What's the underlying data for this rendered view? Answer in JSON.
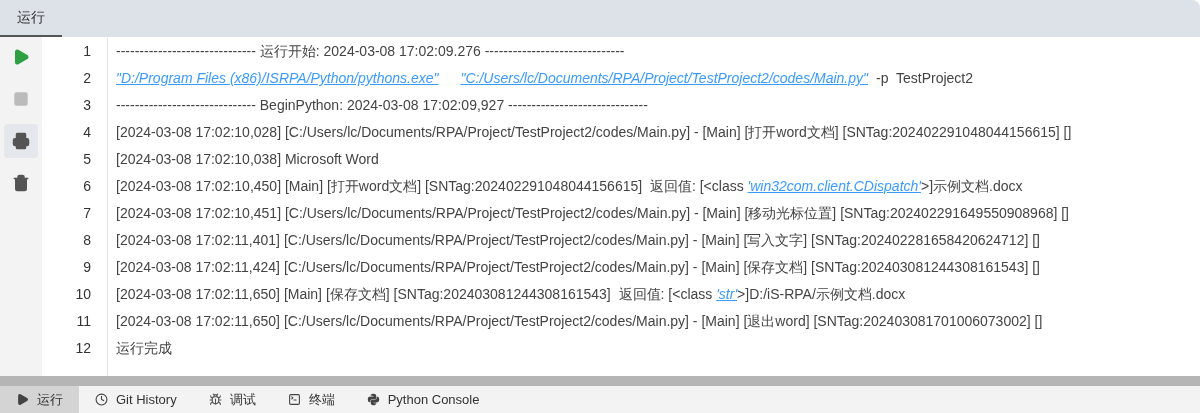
{
  "top_tabs": [
    {
      "label": "运行",
      "selected": true
    }
  ],
  "toolbar": [
    {
      "kind": "run",
      "disabled": false,
      "selected": false
    },
    {
      "kind": "stop",
      "disabled": true,
      "selected": false
    },
    {
      "kind": "print",
      "disabled": false,
      "selected": true
    },
    {
      "kind": "clear",
      "disabled": false,
      "selected": false
    }
  ],
  "lines": [
    {
      "number": "1",
      "segments": [
        {
          "kind": "text",
          "text": "------------------------------ 运行开始: 2024-03-08 17:02:09.276 ------------------------------"
        }
      ]
    },
    {
      "number": "2",
      "segments": [
        {
          "kind": "link",
          "text": "\"D:/Program Files (x86)/ISRPA/Python/pythons.exe\""
        },
        {
          "kind": "link",
          "text": "\"C:/Users/lc/Documents/RPA/Project/TestProject2/codes/Main.py\""
        },
        {
          "kind": "text",
          "text": "-p  TestProject2"
        }
      ]
    },
    {
      "number": "3",
      "segments": [
        {
          "kind": "text",
          "text": "------------------------------ BeginPython: 2024-03-08 17:02:09,927 ------------------------------"
        }
      ]
    },
    {
      "number": "4",
      "segments": [
        {
          "kind": "text",
          "text": "[2024-03-08 17:02:10,028] [C:/Users/lc/Documents/RPA/Project/TestProject2/codes/Main.py] - [Main] [打开word文档] [SNTag:202402291048044156615] []"
        }
      ]
    },
    {
      "number": "5",
      "segments": [
        {
          "kind": "text",
          "text": "[2024-03-08 17:02:10,038] Microsoft Word"
        }
      ]
    },
    {
      "number": "6",
      "segments": [
        {
          "kind": "text",
          "text": "[2024-03-08 17:02:10,450] [Main] [打开word文档] [SNTag:202402291048044156615]  返回值: [<class "
        },
        {
          "kind": "link",
          "text": "'win32com.client.CDispatch'"
        },
        {
          "kind": "text",
          "text": ">]示例文档.docx"
        }
      ]
    },
    {
      "number": "7",
      "segments": [
        {
          "kind": "text",
          "text": "[2024-03-08 17:02:10,451] [C:/Users/lc/Documents/RPA/Project/TestProject2/codes/Main.py] - [Main] [移动光标位置] [SNTag:202402291649550908968] []"
        }
      ]
    },
    {
      "number": "8",
      "segments": [
        {
          "kind": "text",
          "text": "[2024-03-08 17:02:11,401] [C:/Users/lc/Documents/RPA/Project/TestProject2/codes/Main.py] - [Main] [写入文字] [SNTag:202402281658420624712] []"
        }
      ]
    },
    {
      "number": "9",
      "segments": [
        {
          "kind": "text",
          "text": "[2024-03-08 17:02:11,424] [C:/Users/lc/Documents/RPA/Project/TestProject2/codes/Main.py] - [Main] [保存文档] [SNTag:202403081244308161543] []"
        }
      ]
    },
    {
      "number": "10",
      "segments": [
        {
          "kind": "text",
          "text": "[2024-03-08 17:02:11,650] [Main] [保存文档] [SNTag:202403081244308161543]  返回值: [<class "
        },
        {
          "kind": "link",
          "text": "'str'"
        },
        {
          "kind": "text",
          "text": ">]D:/iS-RPA/示例文档.docx"
        }
      ]
    },
    {
      "number": "11",
      "segments": [
        {
          "kind": "text",
          "text": "[2024-03-08 17:02:11,650] [C:/Users/lc/Documents/RPA/Project/TestProject2/codes/Main.py] - [Main] [退出word] [SNTag:202403081701006073002] []"
        }
      ]
    },
    {
      "number": "12",
      "segments": [
        {
          "kind": "text",
          "text": "运行完成"
        }
      ]
    }
  ],
  "bottom_tabs": [
    {
      "label": "运行",
      "selected": true
    },
    {
      "label": "Git History",
      "selected": false
    },
    {
      "label": "调试",
      "selected": false
    },
    {
      "label": "终端",
      "selected": false
    },
    {
      "label": "Python Console",
      "selected": false
    }
  ]
}
